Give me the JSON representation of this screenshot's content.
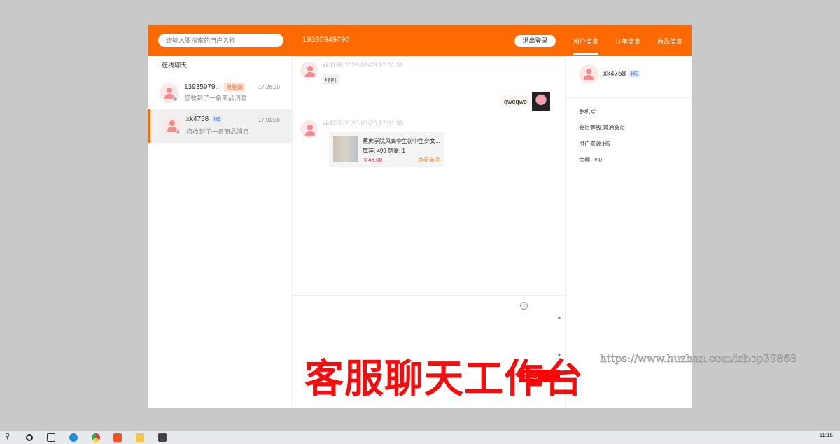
{
  "header": {
    "search_placeholder": "请输入要搜索的用户名称",
    "phone": "19335949790",
    "logout": "退出登录",
    "tabs": [
      "用户信息",
      "订单信息",
      "商品信息"
    ]
  },
  "sidebar": {
    "title": "在线聊天",
    "conversations": [
      {
        "name": "13935979...",
        "badge": "电脑端",
        "time": "17:26:30",
        "message": "您收到了一条商品消息"
      },
      {
        "name": "xk4758",
        "badge": "H5",
        "time": "17:01:38",
        "message": "您收到了一条商品消息"
      }
    ]
  },
  "chat": {
    "messages": [
      {
        "meta": "xk4758 2025-03-26 17:01:31",
        "text": "qqq"
      },
      {
        "text": "qweqwe"
      },
      {
        "meta": "xk4758 2025-03-26 17:01:38",
        "product": {
          "title": "蒸虎学院风高中生初中生少女...",
          "stock": "库存: 499 销量: 1",
          "price": "￥48.00",
          "link": "查看商品"
        }
      }
    ]
  },
  "composer": {
    "send": "发送(",
    "emoji_icon": "☺"
  },
  "user_info": {
    "name": "xk4758",
    "badge": "H5",
    "fields": [
      "手机号:",
      "会员等级:普通会员",
      "用户来源:H5",
      "余额: ￥0"
    ]
  },
  "overlay": {
    "title": "客服聊天工作台",
    "url": "https://www.huzhan.com/ishop39868"
  },
  "taskbar": {
    "time": "11:15"
  },
  "colors": {
    "accent": "#ff6a00",
    "overlay": "#f40d0d"
  }
}
